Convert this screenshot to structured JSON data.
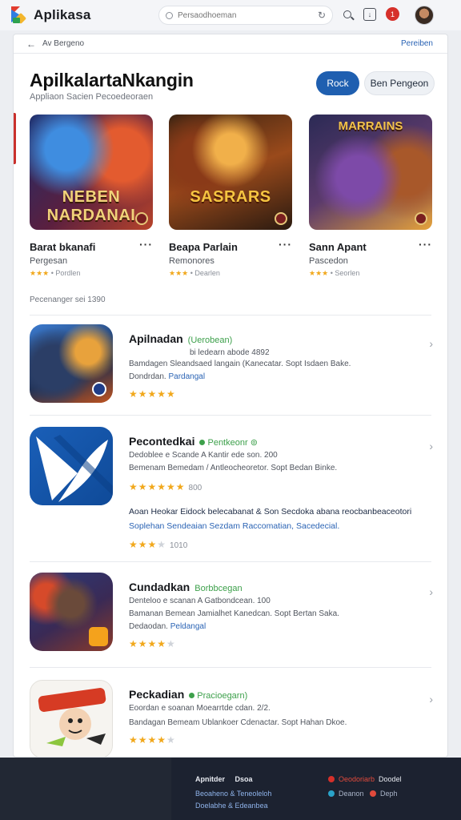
{
  "app": {
    "title": "Aplikasa"
  },
  "search": {
    "placeholder": "Persaodhoeman",
    "reload_icon": "reload-icon"
  },
  "toolbar": {
    "notif_count": "1"
  },
  "breadcrumb": {
    "back": "Av",
    "label": "Bergeno",
    "right_link": "Pereiben"
  },
  "hero": {
    "title": "ApilkalartaNkangin",
    "subtitle": "Appliaon Sacien  Pecoedeoraen",
    "primary_button": "Rock",
    "secondary_button": "Ben Pengeon"
  },
  "featured": [
    {
      "title": "Barat bkanafi",
      "category": "Pergesan",
      "stars": "★★★",
      "meta": "Pordlen",
      "art_text": "NEBEN\nNARDANAI",
      "colors": [
        "#3a1b6e",
        "#e0542a",
        "#2a6cc9"
      ]
    },
    {
      "title": "Beapa Parlain",
      "category": "Remonores",
      "stars": "★★★",
      "meta": "Dearlen",
      "art_text": "SASRARS",
      "colors": [
        "#5b2c14",
        "#f29a2e",
        "#2c2c2c"
      ]
    },
    {
      "title": "Sann Apant",
      "category": "Pascedon",
      "stars": "★★★",
      "meta": "Seorlen",
      "art_text": "MARRAINS",
      "colors": [
        "#402b62",
        "#e9a83b",
        "#6a3b22"
      ]
    }
  ],
  "section": {
    "label": "Pecenanger sei 1390"
  },
  "apps": [
    {
      "name": "Apilnadan",
      "tag": "(Uerobean)",
      "version": "bi ledearn abode 4892",
      "desc": "Bamdagen Sleandsaed langain (Kanecatar. Sopt Isdaen Bake.",
      "detail_prefix": "Dondrdan.",
      "detail_link": "Pardangal",
      "stars": "★★★★★",
      "stars_off": "",
      "count": ""
    },
    {
      "name": "Pecontedkai",
      "tag": "Pentkeonr",
      "version": "Dedoblee e Scande A Kantir ede son. 200",
      "desc": "Bemenam Bemedam / Antleocheoretor. Sopt Bedan Binke.",
      "detail_prefix": "",
      "detail_link": "",
      "stars": "★★★★★★",
      "stars_off": "",
      "count": "800",
      "extra1": "Aoan Heokar Eidock belecabanat & Son Secdoka abana reocbanbeaceotori",
      "extra2": "Soplehan  Sendeaian  Sezdam  Raccomatian,  Sacedecial.",
      "rating2": "★★★",
      "rating2_off": "★",
      "rating2_count": "1010"
    },
    {
      "name": "Cundadkan",
      "tag": "Borbbcegan",
      "version": "Denteloo e scanan A Gatbondcean. 100",
      "desc": "Bamanan Bemean Jamialhet Kanedcan. Sopt Bertan Saka.",
      "detail_prefix": "Dedaodan.",
      "detail_link": "Peldangal",
      "stars": "★★★★",
      "stars_off": "★",
      "count": ""
    },
    {
      "name": "Peckadian",
      "tag": "Pracioegarn)",
      "version": "Eoordan e soanan Moearrtde cdan. 2/2.",
      "desc": "Bandagan Bemeam Ublankoer Cdenactar. Sopt Hahan Dkoe.",
      "detail_prefix": "",
      "detail_link": "",
      "stars": "★★★★",
      "stars_off": "★",
      "count": ""
    }
  ],
  "footer": {
    "col1_title": "Apnitder",
    "col1_sub": "Dsoa",
    "col1_line1": "Beoaheno & Teneoleloh",
    "col1_line2": "Doelabhe & Edeanbea",
    "col2_title": "Oeodoriarb",
    "col2_sub": "Doodel",
    "col2_line1": "Deanon",
    "col2_line2": "Deph",
    "dot_colors": [
      "#d6302a",
      "#2aa3c9",
      "#e04a3c"
    ]
  }
}
